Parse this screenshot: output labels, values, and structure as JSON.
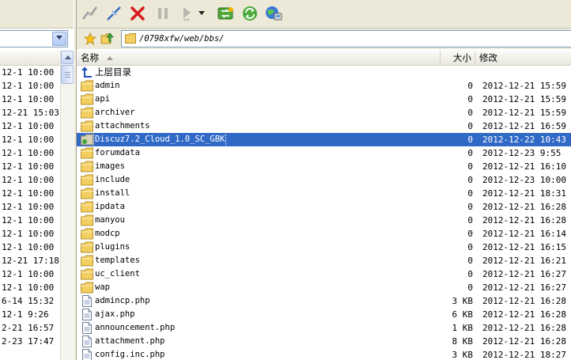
{
  "left_pane": {
    "times": [
      "12-1 10:00",
      "12-1 10:00",
      "12-1 10:00",
      "12-21 15:03",
      "12-1 10:00",
      "12-1 10:00",
      "12-1 10:00",
      "12-1 10:00",
      "12-1 10:00",
      "12-1 10:00",
      "12-1 10:00",
      "12-1 10:00",
      "12-1 10:00",
      "12-1 10:00",
      "12-21 17:18",
      "12-1 10:00",
      "12-1 10:00",
      "6-14 15:32",
      "12-1 9:26",
      "2-21 16:57",
      "2-23 17:47"
    ]
  },
  "toolbar": {
    "buttons": [
      "connect-icon",
      "disconnect-icon",
      "stop-icon",
      "pause-icon",
      "play-icon",
      "transfer-dropdown-icon",
      "refresh-icon",
      "sync-icon",
      "site-manager-icon"
    ]
  },
  "address": {
    "path": "/0798xfw/web/bbs/"
  },
  "columns": {
    "name": "名称",
    "size": "大小",
    "modified": "修改"
  },
  "files": [
    {
      "name": "上层目录",
      "size": "",
      "date": "",
      "type": "up"
    },
    {
      "name": "admin",
      "size": "0",
      "date": "2012-12-21 15:59",
      "type": "folder"
    },
    {
      "name": "api",
      "size": "0",
      "date": "2012-12-21 15:59",
      "type": "folder"
    },
    {
      "name": "archiver",
      "size": "0",
      "date": "2012-12-21 15:59",
      "type": "folder"
    },
    {
      "name": "attachments",
      "size": "0",
      "date": "2012-12-21 16:59",
      "type": "folder"
    },
    {
      "name": "Discuz7.2_Cloud_1.0_SC_GBK",
      "size": "0",
      "date": "2012-12-22 10:43",
      "type": "folder-special",
      "selected": true
    },
    {
      "name": "forumdata",
      "size": "0",
      "date": "2012-12-23 9:55",
      "type": "folder"
    },
    {
      "name": "images",
      "size": "0",
      "date": "2012-12-21 16:10",
      "type": "folder"
    },
    {
      "name": "include",
      "size": "0",
      "date": "2012-12-23 10:00",
      "type": "folder"
    },
    {
      "name": "install",
      "size": "0",
      "date": "2012-12-21 18:31",
      "type": "folder"
    },
    {
      "name": "ipdata",
      "size": "0",
      "date": "2012-12-21 16:28",
      "type": "folder"
    },
    {
      "name": "manyou",
      "size": "0",
      "date": "2012-12-21 16:28",
      "type": "folder"
    },
    {
      "name": "modcp",
      "size": "0",
      "date": "2012-12-21 16:14",
      "type": "folder"
    },
    {
      "name": "plugins",
      "size": "0",
      "date": "2012-12-21 16:15",
      "type": "folder"
    },
    {
      "name": "templates",
      "size": "0",
      "date": "2012-12-21 16:21",
      "type": "folder"
    },
    {
      "name": "uc_client",
      "size": "0",
      "date": "2012-12-21 16:27",
      "type": "folder"
    },
    {
      "name": "wap",
      "size": "0",
      "date": "2012-12-21 16:27",
      "type": "folder"
    },
    {
      "name": "admincp.php",
      "size": "3 KB",
      "date": "2012-12-21 16:28",
      "type": "file"
    },
    {
      "name": "ajax.php",
      "size": "6 KB",
      "date": "2012-12-21 16:28",
      "type": "file"
    },
    {
      "name": "announcement.php",
      "size": "1 KB",
      "date": "2012-12-21 16:28",
      "type": "file"
    },
    {
      "name": "attachment.php",
      "size": "8 KB",
      "date": "2012-12-21 16:28",
      "type": "file"
    },
    {
      "name": "config.inc.php",
      "size": "3 KB",
      "date": "2012-12-21 18:27",
      "type": "file"
    }
  ],
  "colors": {
    "selection": "#3169c6",
    "toolbar_bg": "#ece9d8",
    "folder": "#f3cf62"
  }
}
